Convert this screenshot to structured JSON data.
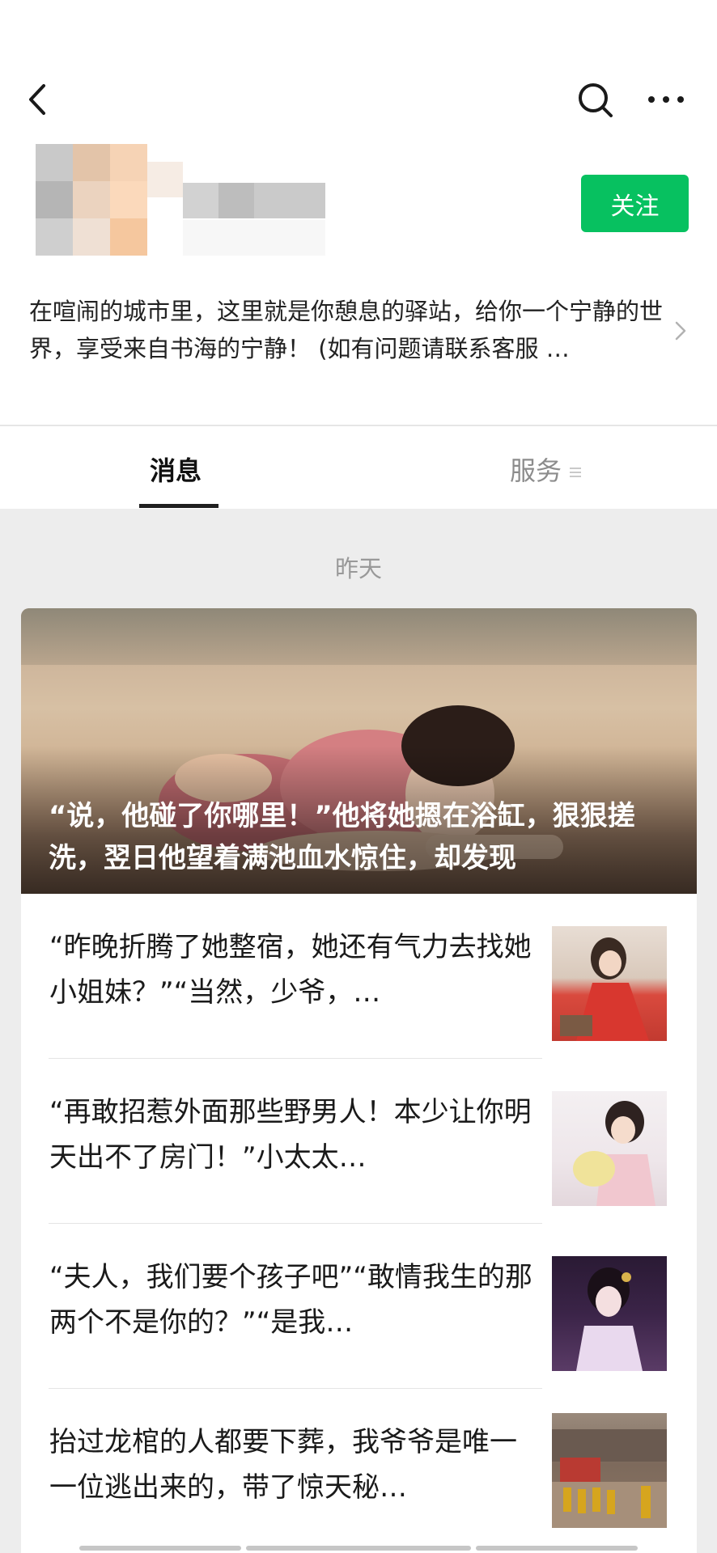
{
  "header": {
    "follow_label": "关注",
    "description": "在喧闹的城市里，这里就是你憩息的驿站，给你一个宁静的世界，享受来自书海的宁静！ (如有问题请联系客服 …"
  },
  "tabs": [
    {
      "label": "消息",
      "active": true
    },
    {
      "label": "服务",
      "active": false
    }
  ],
  "date_label": "昨天",
  "hero": {
    "title": "“说，他碰了你哪里！”他将她摁在浴缸，狠狠搓洗，翌日他望着满池血水惊住，却发现"
  },
  "articles": [
    {
      "text": "“昨晚折腾了她整宿，她还有气力去找她小姐妹？”“当然，少爷，…",
      "thumb": "woman-red-dress-thumbnail"
    },
    {
      "text": "“再敢招惹外面那些野男人！本少让你明天出不了房门！”小太太…",
      "thumb": "woman-pink-thumbnail"
    },
    {
      "text": "“夫人，我们要个孩子吧”“敢情我生的那两个不是你的？”“是我…",
      "thumb": "woman-hanfu-thumbnail"
    },
    {
      "text": "抬过龙棺的人都要下葬，我爷爷是唯一一位逃出来的，带了惊天秘…",
      "thumb": "procession-thumbnail"
    }
  ],
  "colors": {
    "accent": "#07c160",
    "background": "#ededed"
  }
}
